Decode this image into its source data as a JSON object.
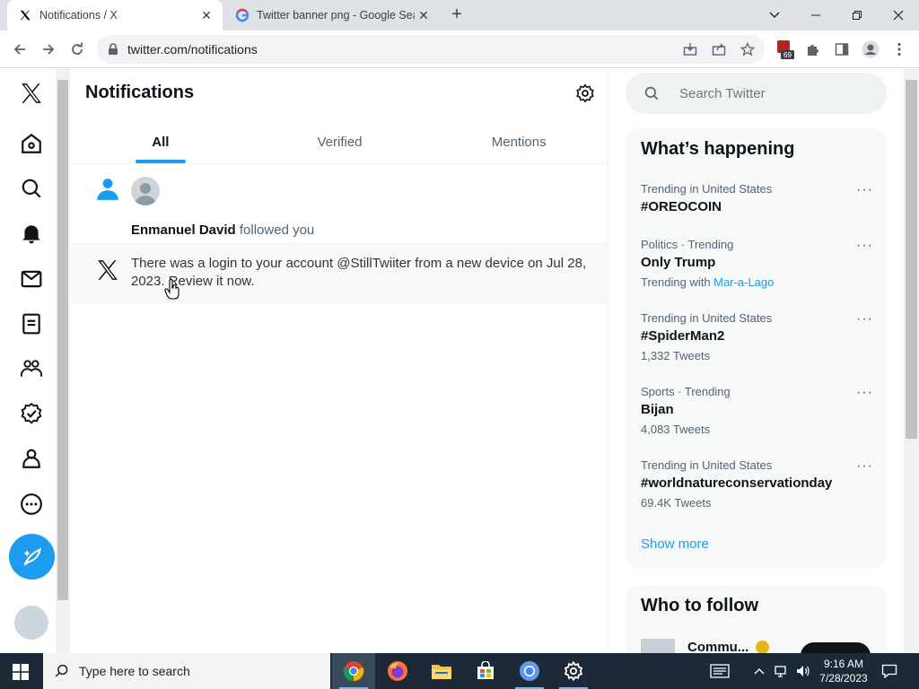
{
  "browser": {
    "tabs": [
      {
        "title": "Notifications / X",
        "active": true
      },
      {
        "title": "Twitter banner png - Google Sea",
        "active": false
      }
    ],
    "url": "twitter.com/notifications",
    "extension_badge": "69"
  },
  "main": {
    "title": "Notifications",
    "tabs": [
      "All",
      "Verified",
      "Mentions"
    ],
    "notifications": [
      {
        "user": "Enmanuel David",
        "text": " followed you"
      },
      {
        "text": "There was a login to your account @StillTwiiter from a new device on Jul 28, 2023. Review it now."
      }
    ]
  },
  "right": {
    "search_placeholder": "Search Twitter",
    "happening_title": "What’s happening",
    "trends": [
      {
        "meta": "Trending in United States",
        "name": "#OREOCOIN",
        "sub": ""
      },
      {
        "meta": "Politics · Trending",
        "name": "Only Trump",
        "sub_prefix": "Trending with ",
        "sub_link": "Mar-a-Lago"
      },
      {
        "meta": "Trending in United States",
        "name": "#SpiderMan2",
        "sub": "1,332 Tweets"
      },
      {
        "meta": "Sports · Trending",
        "name": "Bijan",
        "sub": "4,083 Tweets"
      },
      {
        "meta": "Trending in United States",
        "name": "#worldnatureconservationday",
        "sub": "69.4K Tweets"
      }
    ],
    "show_more": "Show more",
    "who_to_follow_title": "Who to follow",
    "who_to_follow_first": "Commu..."
  },
  "taskbar": {
    "search_placeholder": "Type here to search",
    "time": "9:16 AM",
    "date": "7/28/2023"
  },
  "colors": {
    "accent": "#1d9bf0",
    "text": "#0f1419",
    "muted": "#536471"
  }
}
